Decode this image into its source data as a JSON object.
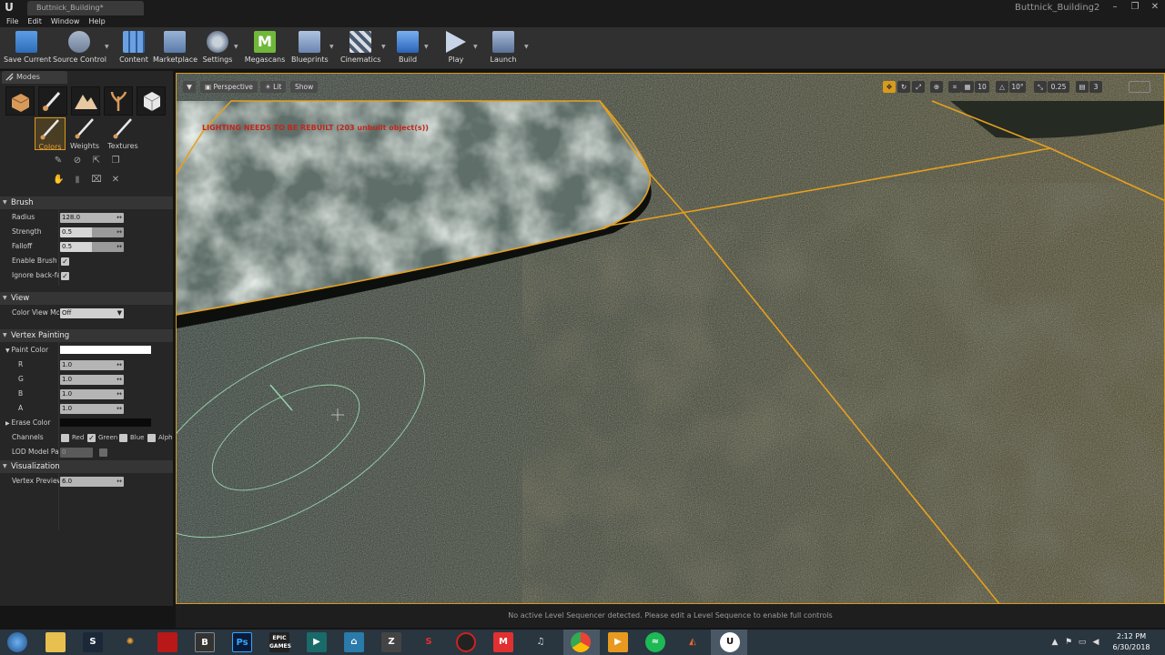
{
  "window": {
    "doc_tab": "Buttnick_Building*",
    "project": "Buttnick_Building2",
    "controls": [
      "–",
      "❐",
      "✕"
    ]
  },
  "menu": [
    "File",
    "Edit",
    "Window",
    "Help"
  ],
  "toolbar": {
    "buttons": [
      {
        "label": "Save Current",
        "icon": "save-icon",
        "color": "#4a8ed8"
      },
      {
        "label": "Source Control",
        "icon": "source-control-icon",
        "color": "#8aa0c0"
      },
      {
        "label": "Content",
        "icon": "content-icon",
        "color": "#5a8fd0"
      },
      {
        "label": "Marketplace",
        "icon": "marketplace-icon",
        "color": "#7aa0d0"
      },
      {
        "label": "Settings",
        "icon": "settings-icon",
        "color": "#8a9ab0"
      },
      {
        "label": "Megascans",
        "icon": "megascans-icon",
        "color": "#6fb83a"
      },
      {
        "label": "Blueprints",
        "icon": "blueprints-icon",
        "color": "#7a9ac8"
      },
      {
        "label": "Cinematics",
        "icon": "cinematics-icon",
        "color": "#8a9ab0"
      },
      {
        "label": "Build",
        "icon": "build-icon",
        "color": "#5a90d8"
      },
      {
        "label": "Play",
        "icon": "play-icon",
        "color": "#90a8d8"
      },
      {
        "label": "Launch",
        "icon": "launch-icon",
        "color": "#7a9ac8"
      }
    ]
  },
  "modes": {
    "tab_label": "Modes",
    "paint_modes": [
      {
        "label": "Colors",
        "active": true
      },
      {
        "label": "Weights",
        "active": false
      },
      {
        "label": "Textures",
        "active": false
      }
    ]
  },
  "brush": {
    "header": "Brush",
    "radius_label": "Radius",
    "radius": "128.0",
    "strength_label": "Strength",
    "strength": "0.5",
    "falloff_label": "Falloff",
    "falloff": "0.5",
    "enable_flow_label": "Enable Brush F",
    "ignore_back_label": "Ignore back-fa"
  },
  "view": {
    "header": "View",
    "color_view_label": "Color View Mo",
    "color_view_value": "Off"
  },
  "vertex_painting": {
    "header": "Vertex Painting",
    "paint_color_label": "Paint Color",
    "r_label": "R",
    "r": "1.0",
    "g_label": "G",
    "g": "1.0",
    "b_label": "B",
    "b": "1.0",
    "a_label": "A",
    "a": "1.0",
    "erase_color_label": "Erase Color",
    "channels_label": "Channels",
    "channel_red": "Red",
    "channel_green": "Green",
    "channel_blue": "Blue",
    "channel_alpha": "Alph",
    "lod_label": "LOD Model Pai",
    "lod_value": "0"
  },
  "visualization": {
    "header": "Visualization",
    "vertex_preview_label": "Vertex Preview",
    "vertex_preview_value": "6.0"
  },
  "viewport": {
    "perspective": "Perspective",
    "lit": "Lit",
    "show": "Show",
    "grid_snap": "10",
    "rot_snap": "10°",
    "scale_snap": "0.25",
    "camera_speed": "3",
    "warning": "LIGHTING NEEDS TO BE REBUILT (203 unbuilt object(s))"
  },
  "status": {
    "message": "No active Level Sequencer detected. Please edit a Level Sequence to enable full controls"
  },
  "taskbar": {
    "time": "2:12 PM",
    "date": "6/30/2018"
  }
}
